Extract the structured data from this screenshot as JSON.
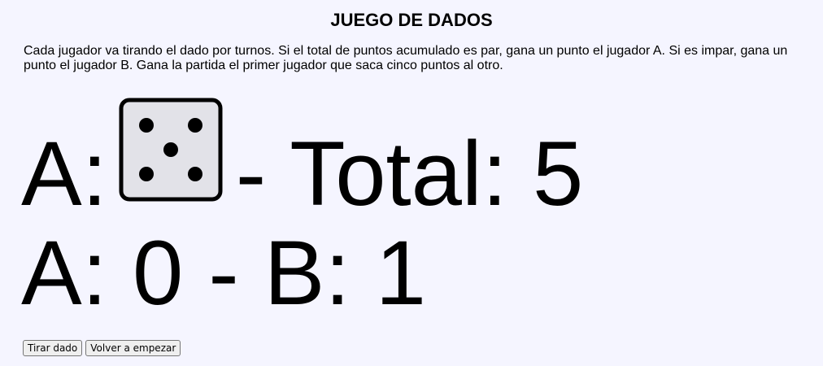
{
  "title": "JUEGO DE DADOS",
  "description": "Cada jugador va tirando el dado por turnos. Si el total de puntos acumulado es par, gana un punto el jugador A. Si es impar, gana un punto el jugador B. Gana la partida el primer jugador que saca cinco puntos al otro.",
  "turn": {
    "player_label": "A:",
    "die_value": 5,
    "die_icon": "die-face-5-icon",
    "total_label": "- Total: 5"
  },
  "score": {
    "text": "A: 0 - B: 1"
  },
  "buttons": {
    "roll_label": "Tirar dado",
    "restart_label": "Volver a empezar"
  },
  "colors": {
    "background": "#f5f5ff",
    "die_face": "#e2e2e8",
    "die_border": "#000000"
  }
}
